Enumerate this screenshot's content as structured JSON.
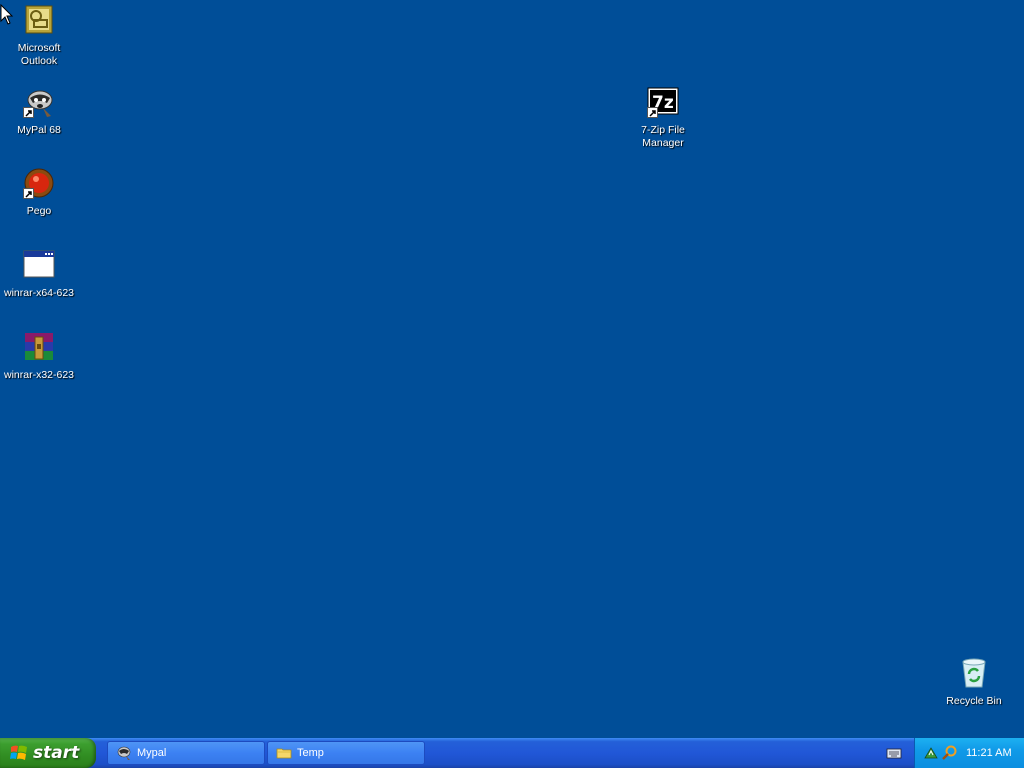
{
  "desktop": {
    "icons": [
      {
        "label": "Microsoft\nOutlook",
        "icon": "outlook-icon"
      },
      {
        "label": "MyPal 68",
        "icon": "mypal-icon"
      },
      {
        "label": "Pego",
        "icon": "pego-icon"
      },
      {
        "label": "winrar-x64-623",
        "icon": "installer-window-icon"
      },
      {
        "label": "winrar-x32-623",
        "icon": "winrar-icon"
      },
      {
        "label": "7-Zip File\nManager",
        "icon": "7zip-icon"
      },
      {
        "label": "Recycle Bin",
        "icon": "recycle-bin-icon"
      }
    ]
  },
  "taskbar": {
    "start_label": "start",
    "tasks": [
      {
        "label": "Mypal",
        "icon": "mypal-icon"
      },
      {
        "label": "Temp",
        "icon": "folder-icon"
      }
    ],
    "tray": {
      "clock": "11:21 AM",
      "icons": [
        "network-icon",
        "search-icon"
      ]
    }
  },
  "colors": {
    "desktop_bg": "#004e98",
    "taskbar": "#2157d7",
    "start_button": "#3c9e2f",
    "tray": "#0c8ee0"
  }
}
